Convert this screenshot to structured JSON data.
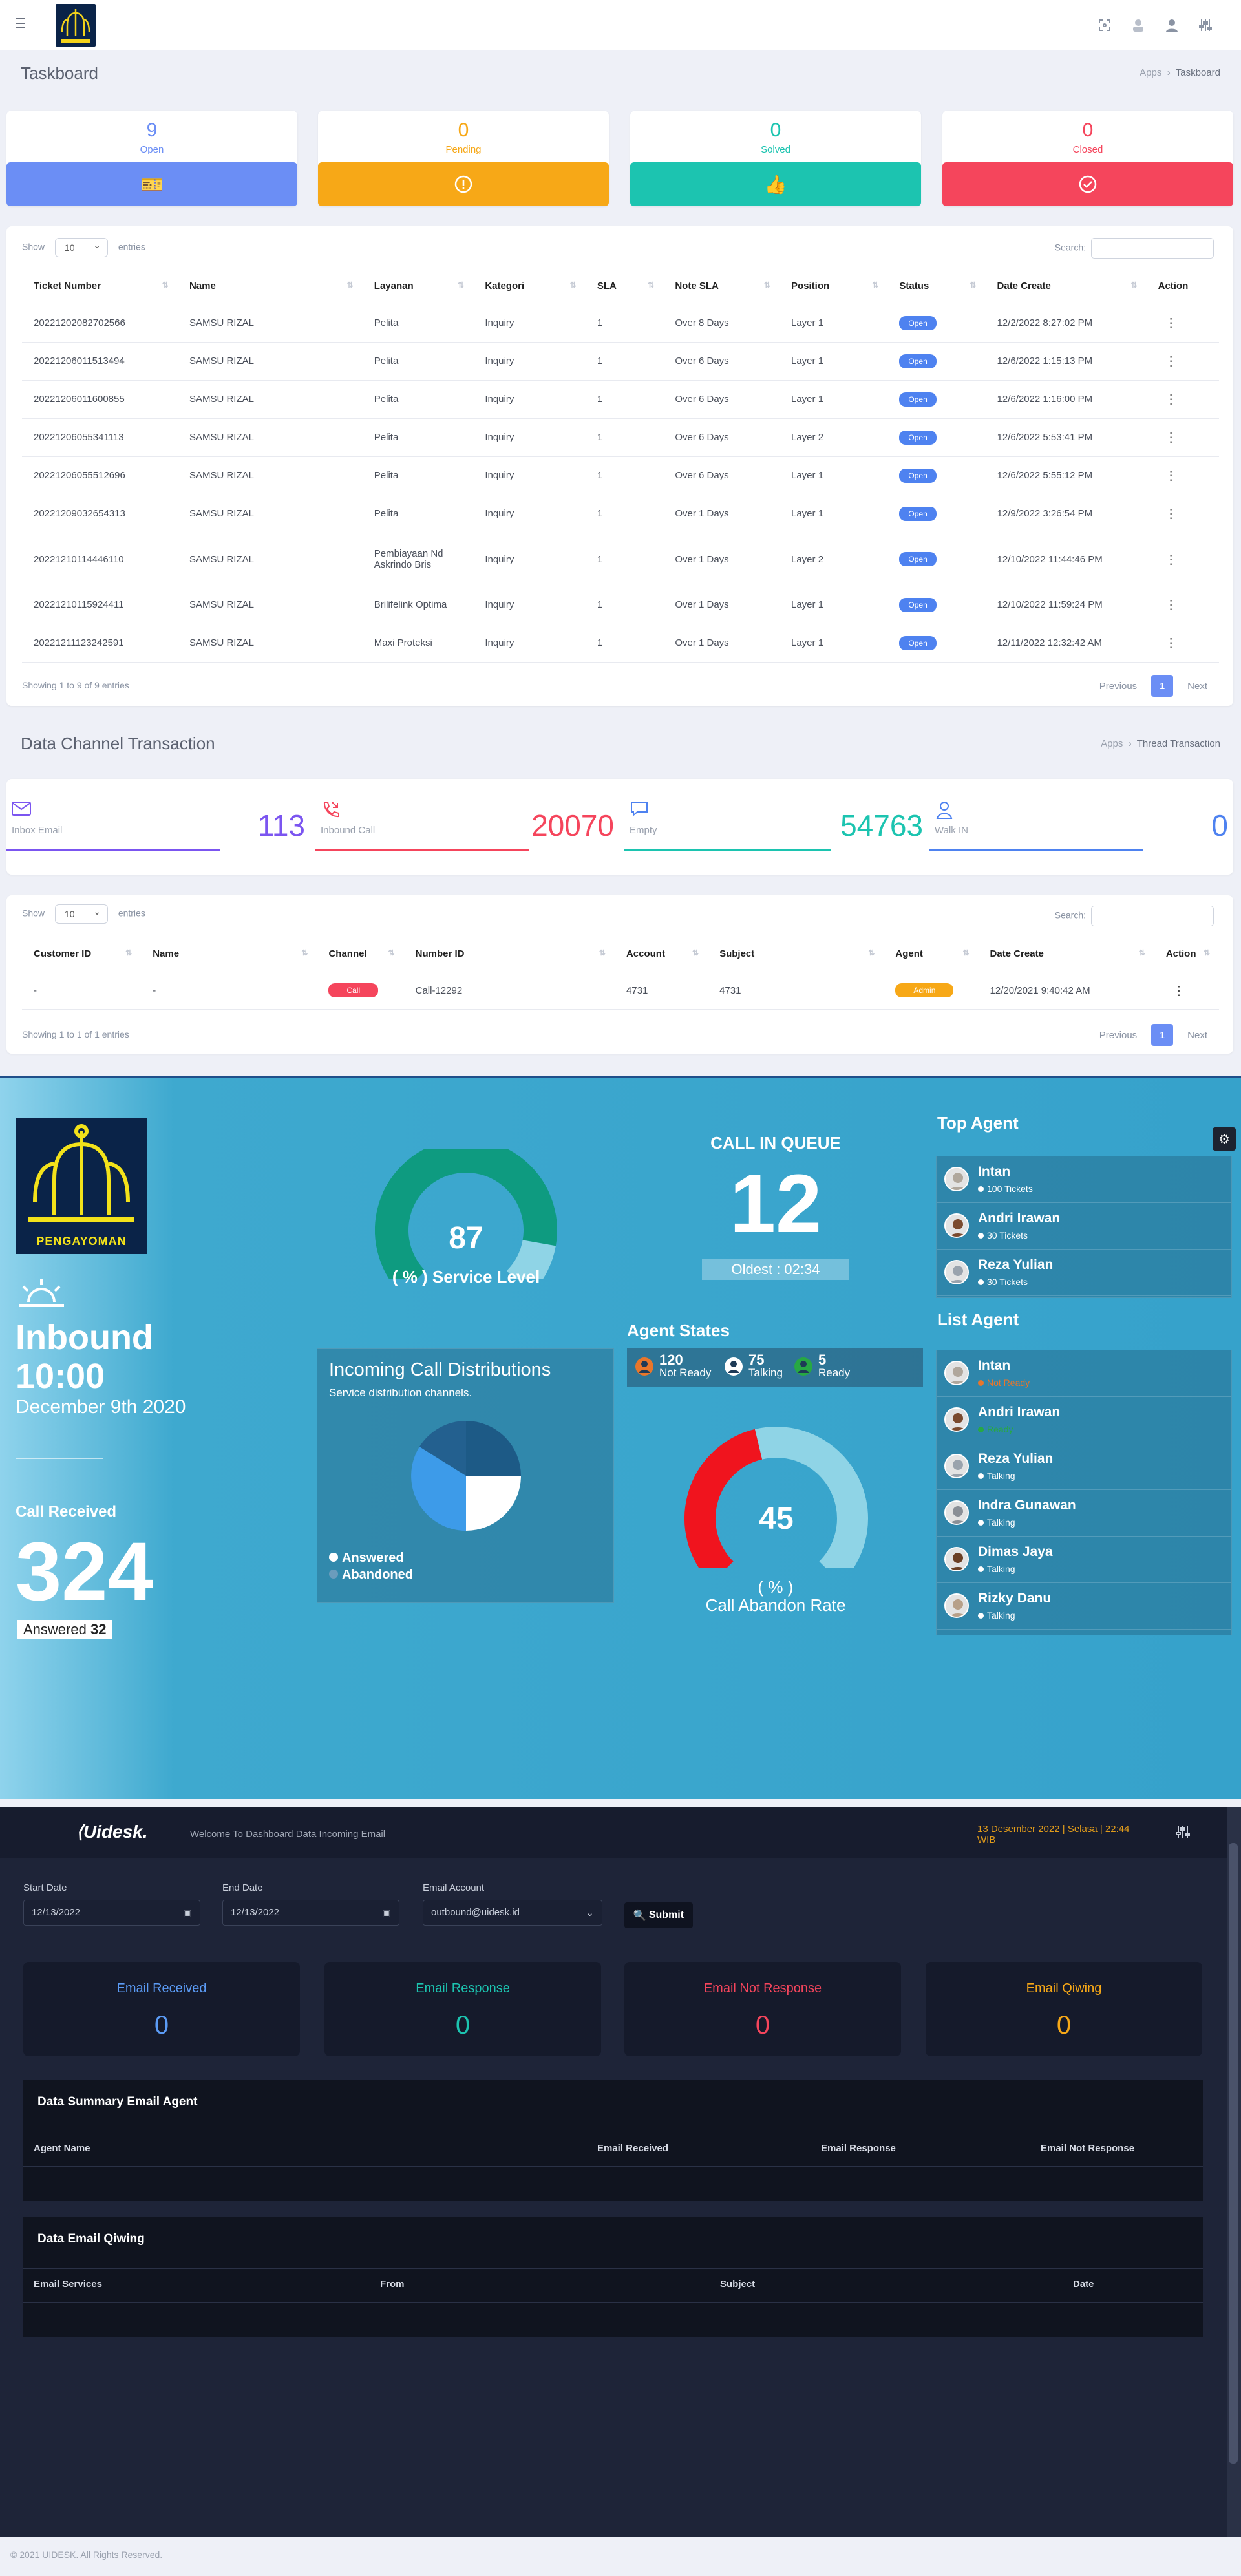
{
  "header": {
    "page_title": "Taskboard",
    "breadcrumb": [
      "Apps",
      "Taskboard"
    ]
  },
  "stats": [
    {
      "value": "9",
      "label": "Open",
      "color": "#6b8ef5",
      "icon": "ticket-icon"
    },
    {
      "value": "0",
      "label": "Pending",
      "color": "#f7a817",
      "icon": "alert-icon"
    },
    {
      "value": "0",
      "label": "Solved",
      "color": "#1cc4b0",
      "icon": "thumbs-up-icon"
    },
    {
      "value": "0",
      "label": "Closed",
      "color": "#f5455c",
      "icon": "check-circle-icon"
    }
  ],
  "tickets": {
    "show_label": "Show",
    "entries_value": "10",
    "entries_label": "entries",
    "search_label": "Search:",
    "columns": [
      "Ticket Number",
      "Name",
      "Layanan",
      "Kategori",
      "SLA",
      "Note SLA",
      "Position",
      "Status",
      "Date Create",
      "Action"
    ],
    "rows": [
      [
        "20221202082702566",
        "SAMSU RIZAL",
        "Pelita",
        "Inquiry",
        "1",
        "Over 8 Days",
        "Layer 1",
        "Open",
        "12/2/2022 8:27:02 PM"
      ],
      [
        "20221206011513494",
        "SAMSU RIZAL",
        "Pelita",
        "Inquiry",
        "1",
        "Over 6 Days",
        "Layer 1",
        "Open",
        "12/6/2022 1:15:13 PM"
      ],
      [
        "20221206011600855",
        "SAMSU RIZAL",
        "Pelita",
        "Inquiry",
        "1",
        "Over 6 Days",
        "Layer 1",
        "Open",
        "12/6/2022 1:16:00 PM"
      ],
      [
        "20221206055341113",
        "SAMSU RIZAL",
        "Pelita",
        "Inquiry",
        "1",
        "Over 6 Days",
        "Layer 2",
        "Open",
        "12/6/2022 5:53:41 PM"
      ],
      [
        "20221206055512696",
        "SAMSU RIZAL",
        "Pelita",
        "Inquiry",
        "1",
        "Over 6 Days",
        "Layer 1",
        "Open",
        "12/6/2022 5:55:12 PM"
      ],
      [
        "20221209032654313",
        "SAMSU RIZAL",
        "Pelita",
        "Inquiry",
        "1",
        "Over 1 Days",
        "Layer 1",
        "Open",
        "12/9/2022 3:26:54 PM"
      ],
      [
        "20221210114446110",
        "SAMSU RIZAL",
        "Pembiayaan Nd Askrindo Bris",
        "Inquiry",
        "1",
        "Over 1 Days",
        "Layer 2",
        "Open",
        "12/10/2022 11:44:46 PM"
      ],
      [
        "20221210115924411",
        "SAMSU RIZAL",
        "Brilifelink Optima",
        "Inquiry",
        "1",
        "Over 1 Days",
        "Layer 1",
        "Open",
        "12/10/2022 11:59:24 PM"
      ],
      [
        "20221211123242591",
        "SAMSU RIZAL",
        "Maxi Proteksi",
        "Inquiry",
        "1",
        "Over 1 Days",
        "Layer 1",
        "Open",
        "12/11/2022 12:32:42 AM"
      ]
    ],
    "info": "Showing 1 to 9 of 9 entries",
    "prev": "Previous",
    "page": "1",
    "next": "Next"
  },
  "channel": {
    "title": "Data Channel Transaction",
    "breadcrumb": [
      "Apps",
      "Thread Transaction"
    ],
    "cards": [
      {
        "label": "Inbox Email",
        "value": "113",
        "color": "#7b55f0",
        "icon": "mail-icon"
      },
      {
        "label": "Inbound Call",
        "value": "20070",
        "color": "#f5455c",
        "icon": "phone-icon"
      },
      {
        "label": "Empty",
        "value": "54763",
        "color": "#1cc4b0",
        "icon": "chat-icon"
      },
      {
        "label": "Walk IN",
        "value": "0",
        "color": "#4e82f0",
        "icon": "user-icon"
      }
    ],
    "table": {
      "show_label": "Show",
      "entries_value": "10",
      "entries_label": "entries",
      "search_label": "Search:",
      "columns": [
        "Customer ID",
        "Name",
        "Channel",
        "Number ID",
        "Account",
        "Subject",
        "Agent",
        "Date Create",
        "Action"
      ],
      "row": {
        "customer_id": "-",
        "name": "-",
        "channel": "Call",
        "number_id": "Call-12292",
        "account": "4731",
        "subject": "4731",
        "agent": "Admin",
        "date": "12/20/2021 9:40:42 AM"
      },
      "info": "Showing 1 to 1 of 1 entries",
      "prev": "Previous",
      "page": "1",
      "next": "Next"
    }
  },
  "callcenter": {
    "logo_text": "PENGAYOMAN",
    "inbound": "Inbound",
    "time": "10:00",
    "date": "December 9th 2020",
    "call_received_label": "Call Received",
    "call_received": "324",
    "answered_label": "Answered",
    "answered": "32",
    "service_level_value": "87",
    "service_level_label": "( % ) Service Level",
    "service_level_fraction": 0.87,
    "queue_title": "CALL IN QUEUE",
    "queue_value": "12",
    "oldest_label": "Oldest : 02:34",
    "dist_title": "Incoming Call Distributions",
    "dist_sub": "Service distribution channels.",
    "legend_answered": "Answered",
    "legend_abandoned": "Abandoned",
    "agent_states_title": "Agent States",
    "states": [
      {
        "value": "120",
        "label": "Not Ready",
        "color": "#e8762b"
      },
      {
        "value": "75",
        "label": "Talking",
        "color": "#ffffff"
      },
      {
        "value": "5",
        "label": "Ready",
        "color": "#27a844"
      }
    ],
    "abandon_value": "45",
    "abandon_unit": "( % )",
    "abandon_label": "Call Abandon Rate",
    "abandon_fraction": 0.45,
    "top_agent_title": "Top Agent",
    "top_agents": [
      {
        "name": "Intan",
        "status": "100 Tickets"
      },
      {
        "name": "Andri Irawan",
        "status": "30 Tickets"
      },
      {
        "name": "Reza Yulian",
        "status": "30 Tickets"
      }
    ],
    "list_agent_title": "List Agent",
    "list_agents": [
      {
        "name": "Intan",
        "status": "Not Ready",
        "dot": "#e8762b"
      },
      {
        "name": "Andri Irawan",
        "status": "Ready",
        "dot": "#27a844"
      },
      {
        "name": "Reza Yulian",
        "status": "Talking",
        "dot": "#ffffff"
      },
      {
        "name": "Indra Gunawan",
        "status": "Talking",
        "dot": "#ffffff"
      },
      {
        "name": "Dimas Jaya",
        "status": "Talking",
        "dot": "#ffffff"
      },
      {
        "name": "Rizky Danu",
        "status": "Talking",
        "dot": "#ffffff"
      }
    ]
  },
  "email": {
    "brand": "Uidesk.",
    "welcome": "Welcome To Dashboard Data Incoming Email",
    "datetime_line1": "13 Desember 2022 | Selasa | 22:44",
    "datetime_line2": "WIB",
    "start_date_label": "Start Date",
    "start_date": "12/13/2022",
    "end_date_label": "End Date",
    "end_date": "12/13/2022",
    "account_label": "Email Account",
    "account": "outbound@uidesk.id",
    "submit": "Submit",
    "cards": [
      {
        "title": "Email Received",
        "value": "0",
        "color": "#5b9bf5"
      },
      {
        "title": "Email Response",
        "value": "0",
        "color": "#1cc4b0"
      },
      {
        "title": "Email Not Response",
        "value": "0",
        "color": "#f5455c"
      },
      {
        "title": "Email Qiwing",
        "value": "0",
        "color": "#f7a817"
      }
    ],
    "summary_title": "Data Summary Email Agent",
    "summary_cols": [
      "Agent Name",
      "Email Received",
      "Email Response",
      "Email Not Response"
    ],
    "qiwing_title": "Data Email Qiwing",
    "qiwing_cols": [
      "Email Services",
      "From",
      "Subject",
      "Date"
    ]
  },
  "footer": "© 2021 UIDESK. All Rights Reserved."
}
